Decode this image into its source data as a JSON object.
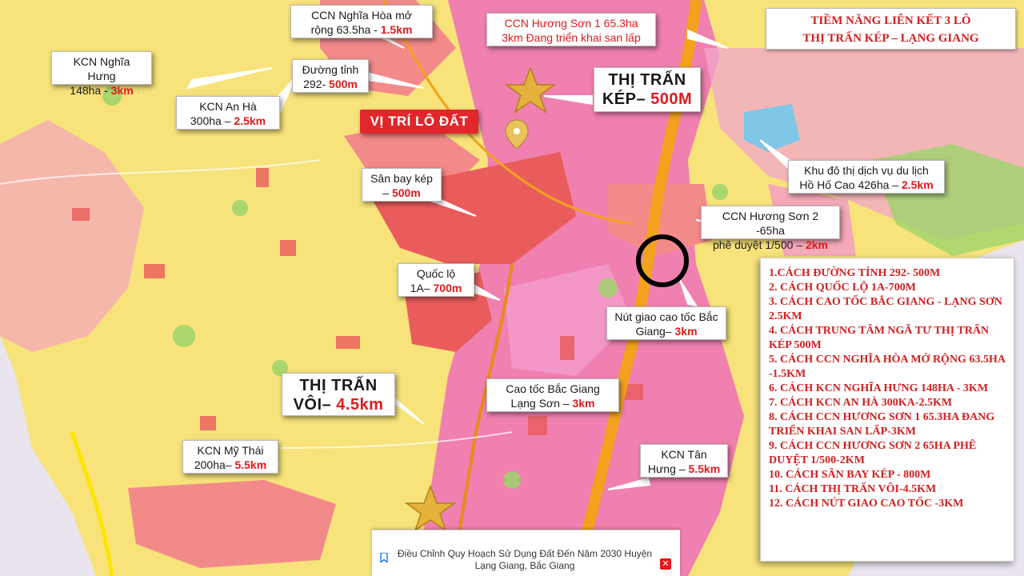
{
  "title": {
    "line1": "TIỀM NĂNG LIÊN KẾT 3 LÔ",
    "line2": "THỊ TRẤN KÉP – LẠNG GIANG"
  },
  "main_marker": {
    "label": "VỊ TRÍ LÔ ĐẤT"
  },
  "callouts": {
    "ccn_nghia_hoa": {
      "line1": "CCN Nghĩa Hòa mở",
      "line2_prefix": "rộng 63.5ha - ",
      "highlight": "1.5km"
    },
    "ccn_huong_son_1": {
      "line1": "CCN Hương Sơn 1 65.3ha",
      "line2": "3km Đang triển khai san lấp"
    },
    "kcn_nghia_hung": {
      "line1": "KCN Nghĩa Hưng",
      "line2_prefix": "148ha - ",
      "highlight": "3km"
    },
    "duong_tinh": {
      "line1": "Đường tỉnh",
      "line2_prefix": "292- ",
      "highlight": "500m"
    },
    "thi_tran_kep": {
      "line1": "THỊ TRẤN",
      "line2_prefix": "KÉP– ",
      "highlight": "500M"
    },
    "kcn_an_ha": {
      "line1": "KCN An Hà",
      "line2_prefix": "300ha – ",
      "highlight": "2.5km"
    },
    "ho_ho_cao": {
      "line1": "Khu đô thị dịch vụ du lịch",
      "line2_prefix": "Hồ Hố Cao 426ha – ",
      "highlight": "2.5km"
    },
    "san_bay_kep": {
      "line1": "Sân bay kép",
      "line2_prefix": "– ",
      "highlight": "500m"
    },
    "ccn_huong_son_2": {
      "line1": "CCN Hương Sơn 2 -65ha",
      "line2_prefix": "phê duyệt 1/500 – ",
      "highlight": "2km"
    },
    "quoc_lo_1a": {
      "line1": "Quốc lộ",
      "line2_prefix": "1A– ",
      "highlight": "700m"
    },
    "nut_giao": {
      "line1": "Nút giao cao tốc Bắc",
      "line2_prefix": "Giang– ",
      "highlight": "3km"
    },
    "thi_tran_voi": {
      "line1": "THỊ TRẤN",
      "line2_prefix": "VÔI– ",
      "highlight": "4.5km"
    },
    "cao_toc": {
      "line1": "Cao tốc Bắc Giang",
      "line2_prefix": "Lạng Sơn – ",
      "highlight": "3km"
    },
    "kcn_my_thai": {
      "line1": "KCN Mỹ Thái",
      "line2_prefix": "200ha– ",
      "highlight": "5.5km"
    },
    "kcn_tan_hung": {
      "line1": "KCN Tân",
      "line2_prefix": "Hưng – ",
      "highlight": "5.5km"
    }
  },
  "distance_list": [
    "1.CÁCH ĐƯỜNG TỈNH 292- 500M",
    "2. CÁCH QUỐC LỘ 1A-700M",
    "3. CÁCH CAO TỐC BẮC GIANG - LẠNG SƠN 2.5KM",
    "4. CÁCH TRUNG TÂM NGÃ TƯ THỊ TRẤN KÉP 500M",
    "5. CÁCH CCN NGHĨA HÒA MỞ RỘNG 63.5HA -1.5KM",
    "6. CÁCH KCN NGHĨA HƯNG 148HA - 3KM",
    "7. CÁCH KCN AN HÀ 300KA-2.5KM",
    "8. CÁCH CCN HƯƠNG SƠN 1 65.3HA ĐANG TRIỂN KHAI SAN LẤP-3KM",
    "9. CÁCH CCN HƯƠNG SƠN 2 65HA PHÊ DUYỆT 1/500-2KM",
    "10. CÁCH SÂN BAY KÉP - 800M",
    "11. CÁCH THỊ TRẤN VÔI-4.5KM",
    "12. CÁCH NÚT GIAO CAO TỐC -3KM"
  ],
  "caption": {
    "text": "Điều Chỉnh Quy Hoạch Sử Dụng Đất Đến Năm 2030 Huyện Lạng Giang, Bắc Giang",
    "close_label": "✕"
  },
  "colors": {
    "accent_red": "#e0191d",
    "map_yellow": "#f7e37a",
    "map_pink": "#ef6fb8",
    "map_salmon": "#f38a8a",
    "highway_orange": "#f2a21c"
  },
  "icons": [
    "star-marker-icon",
    "location-pin-icon",
    "bookmark-icon",
    "close-icon"
  ]
}
